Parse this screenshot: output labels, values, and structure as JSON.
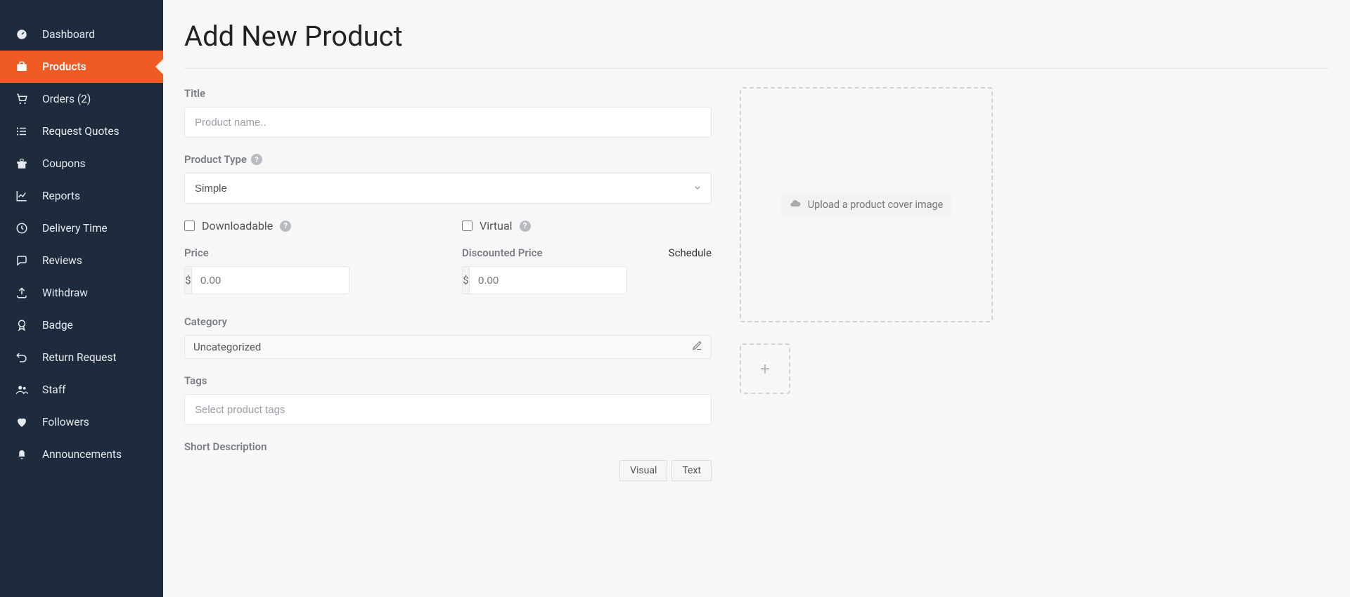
{
  "sidebar": {
    "items": [
      {
        "label": "Dashboard",
        "icon": "gauge"
      },
      {
        "label": "Products",
        "icon": "briefcase",
        "active": true
      },
      {
        "label": "Orders (2)",
        "icon": "cart"
      },
      {
        "label": "Request Quotes",
        "icon": "list"
      },
      {
        "label": "Coupons",
        "icon": "gift"
      },
      {
        "label": "Reports",
        "icon": "chart"
      },
      {
        "label": "Delivery Time",
        "icon": "clock"
      },
      {
        "label": "Reviews",
        "icon": "comments"
      },
      {
        "label": "Withdraw",
        "icon": "upload"
      },
      {
        "label": "Badge",
        "icon": "award"
      },
      {
        "label": "Return Request",
        "icon": "undo"
      },
      {
        "label": "Staff",
        "icon": "users"
      },
      {
        "label": "Followers",
        "icon": "heart"
      },
      {
        "label": "Announcements",
        "icon": "bell"
      }
    ]
  },
  "page": {
    "title": "Add New Product"
  },
  "form": {
    "title_label": "Title",
    "title_placeholder": "Product name..",
    "type_label": "Product Type",
    "type_value": "Simple",
    "downloadable_label": "Downloadable",
    "virtual_label": "Virtual",
    "price_label": "Price",
    "disc_price_label": "Discounted Price",
    "schedule_label": "Schedule",
    "currency": "$",
    "price_placeholder": "0.00",
    "category_label": "Category",
    "category_value": "Uncategorized",
    "tags_label": "Tags",
    "tags_placeholder": "Select product tags",
    "short_desc_label": "Short Description"
  },
  "media": {
    "upload_hint": "Upload a product cover image"
  },
  "editor": {
    "visual_tab": "Visual",
    "text_tab": "Text"
  }
}
